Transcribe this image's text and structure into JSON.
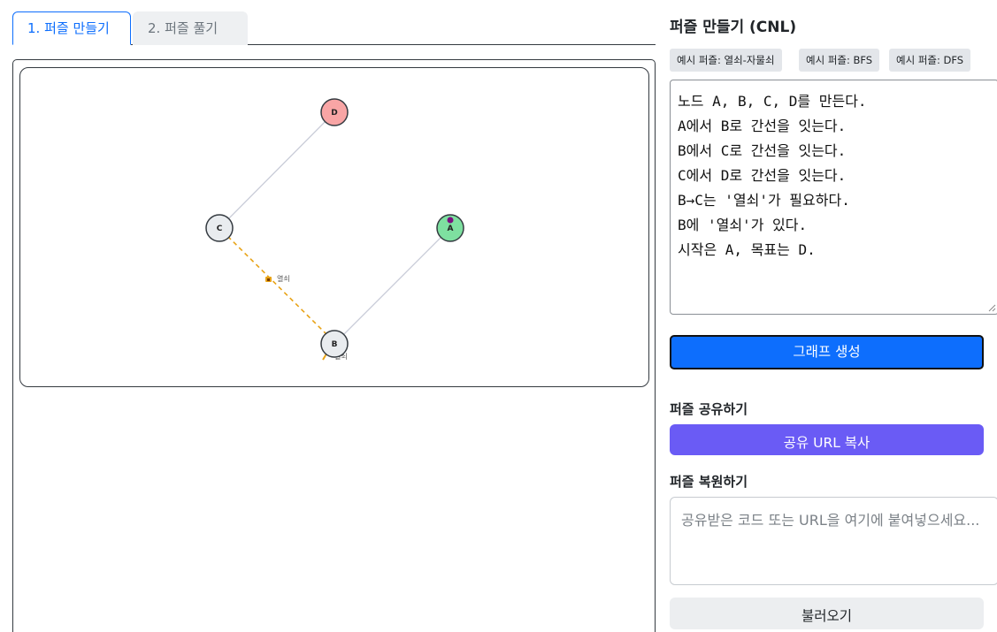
{
  "tabs": [
    {
      "label": "1. 퍼즐 만들기",
      "active": true
    },
    {
      "label": "2. 퍼즐 풀기",
      "active": false
    }
  ],
  "graph": {
    "nodes": [
      {
        "id": "D",
        "color": "#f8a5a5"
      },
      {
        "id": "C",
        "color": "#e9ecef"
      },
      {
        "id": "A",
        "color": "#7ee0a0",
        "marker_color": "#7a1080"
      },
      {
        "id": "B",
        "color": "#e9ecef"
      }
    ],
    "edges": [
      {
        "from": "C",
        "to": "D",
        "style": "normal"
      },
      {
        "from": "B",
        "to": "A",
        "style": "normal"
      },
      {
        "from": "B",
        "to": "C",
        "style": "locked",
        "color": "#e8a317"
      }
    ],
    "edge_label": "열쇠",
    "item_label": "열쇠"
  },
  "side": {
    "title": "퍼즐 만들기 (CNL)",
    "examples": [
      "예시 퍼즐: 열쇠-자물쇠",
      "예시 퍼즐: BFS",
      "예시 퍼즐: DFS"
    ],
    "cnl_lines": [
      "노드 A, B, C, D를 만든다.",
      "A에서 B로 간선을 잇는다.",
      "B에서 C로 간선을 잇는다.",
      "C에서 D로 간선을 잇는다.",
      "B→C는 '열쇠'가 필요하다.",
      "B에 '열쇠'가 있다.",
      "시작은 A, 목표는 D."
    ],
    "generate_label": "그래프 생성",
    "share_title": "퍼즐 공유하기",
    "share_button": "공유 URL 복사",
    "restore_title": "퍼즐 복원하기",
    "restore_placeholder": "공유받은 코드 또는 URL을 여기에 붙여넣으세요...",
    "load_button": "불러오기"
  },
  "colors": {
    "accent": "#0d6efd",
    "share": "#6a5bf5",
    "locked_edge": "#e8a317"
  }
}
